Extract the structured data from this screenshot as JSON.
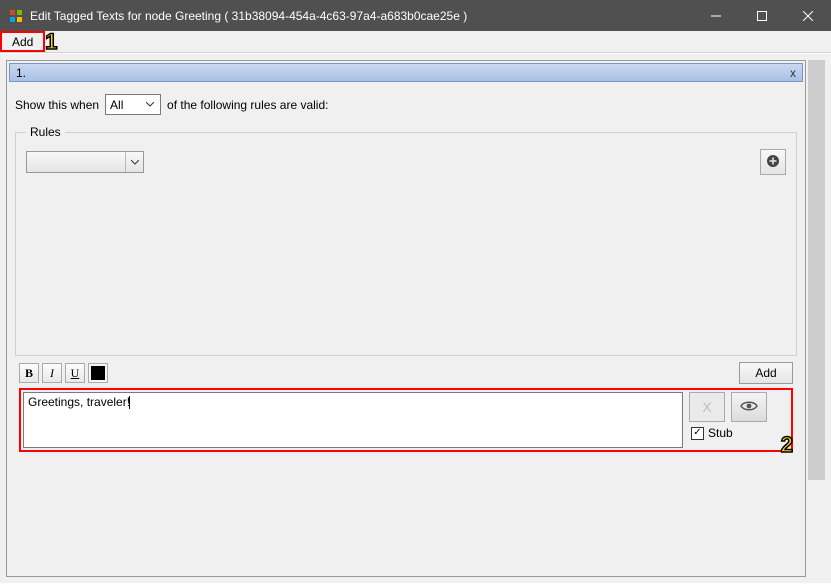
{
  "window": {
    "title": "Edit Tagged Texts for node Greeting ( 31b38094-454a-4c63-97a4-a683b0cae25e )"
  },
  "menubar": {
    "add_label": "Add"
  },
  "annotations": {
    "one": "1",
    "two": "2"
  },
  "section": {
    "number": "1.",
    "close": "x",
    "show_prefix": "Show this when",
    "condition_mode": "All",
    "show_suffix": "of the following rules are valid:",
    "rules_legend": "Rules"
  },
  "format": {
    "bold": "B",
    "italic": "I",
    "underline": "U",
    "add_label": "Add"
  },
  "textentry": {
    "value": "Greetings, traveler!",
    "delete_label": "X",
    "stub_label": "Stub",
    "stub_checked": "✓"
  }
}
